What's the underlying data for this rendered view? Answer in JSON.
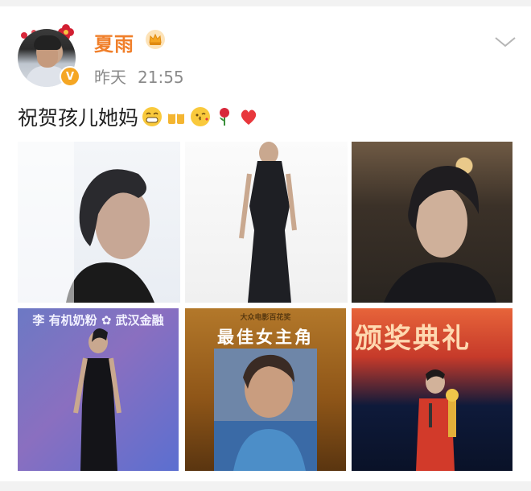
{
  "post": {
    "username": "夏雨",
    "time_day": "昨天",
    "time_clock": "21:55",
    "text": "祝贺孩儿她妈",
    "emojis": [
      "grin-emoji",
      "cheers-emoji",
      "kiss-emoji",
      "rose-emoji",
      "heart-emoji"
    ]
  },
  "photos": {
    "p4_wall_text": "李 有机奶粉  ✿ 武汉金融",
    "p5_sub_text": "大众电影百花奖",
    "p5_title": "最佳女主角",
    "p6_text": "颁奖典礼"
  },
  "colors": {
    "username": "#f07f2a",
    "verified_badge": "#f5a623",
    "heart": "#e8373c"
  }
}
